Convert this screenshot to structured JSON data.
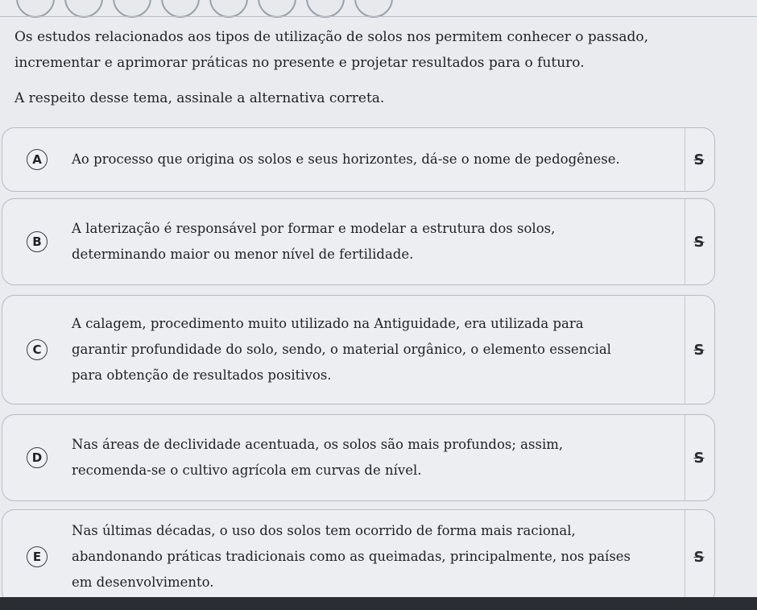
{
  "question": {
    "paragraph_1": "Os estudos relacionados aos tipos de utilização de solos nos permitem conhecer o passado, incrementar e aprimorar práticas no presente e projetar resultados para o futuro.",
    "paragraph_2": "A respeito desse tema, assinale a alternativa correta."
  },
  "alternatives": [
    {
      "letter": "A",
      "text": "Ao processo que origina os solos e seus horizontes, dá-se o nome de pedogênese."
    },
    {
      "letter": "B",
      "text": "A laterização é responsável por formar e modelar a estrutura dos solos, determinando maior ou menor nível de fertilidade."
    },
    {
      "letter": "C",
      "text": "A calagem, procedimento muito utilizado na Antiguidade, era utilizada para garantir profundidade do solo, sendo, o material orgânico, o elemento essencial para obtenção de resultados positivos."
    },
    {
      "letter": "D",
      "text": "Nas áreas de declividade acentuada, os solos são mais profundos; assim, recomenda-se o cultivo agrícola em curvas de nível."
    },
    {
      "letter": "E",
      "text": "Nas últimas décadas, o uso dos solos tem ocorrido de forma mais racional, abandonando práticas tradicionais como as queimadas, principalmente, nos países em desenvolvimento."
    }
  ],
  "strike_glyph": "S"
}
